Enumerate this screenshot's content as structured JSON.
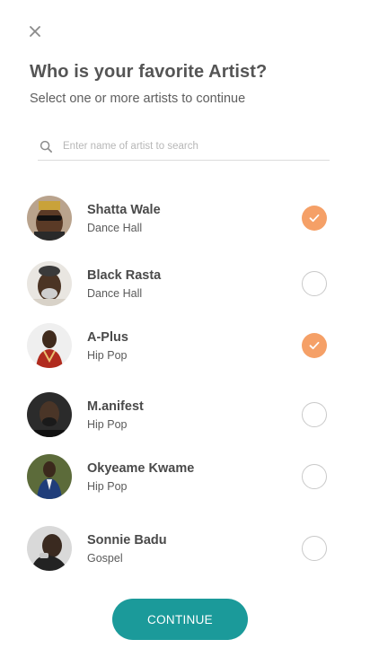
{
  "header": {
    "title": "Who is your favorite Artist?",
    "subtitle": "Select one or more artists to continue"
  },
  "search": {
    "placeholder": "Enter name of artist to search",
    "value": ""
  },
  "artists": [
    {
      "name": "Shatta Wale",
      "genre": "Dance Hall",
      "selected": true
    },
    {
      "name": "Black Rasta",
      "genre": "Dance Hall",
      "selected": false
    },
    {
      "name": "A-Plus",
      "genre": "Hip Pop",
      "selected": true
    },
    {
      "name": "M.anifest",
      "genre": "Hip Pop",
      "selected": false
    },
    {
      "name": "Okyeame Kwame",
      "genre": "Hip Pop",
      "selected": false
    },
    {
      "name": "Sonnie Badu",
      "genre": "Gospel",
      "selected": false
    }
  ],
  "continue_label": "CONTINUE",
  "colors": {
    "accent": "#1b9a9a",
    "check": "#f5a067"
  }
}
